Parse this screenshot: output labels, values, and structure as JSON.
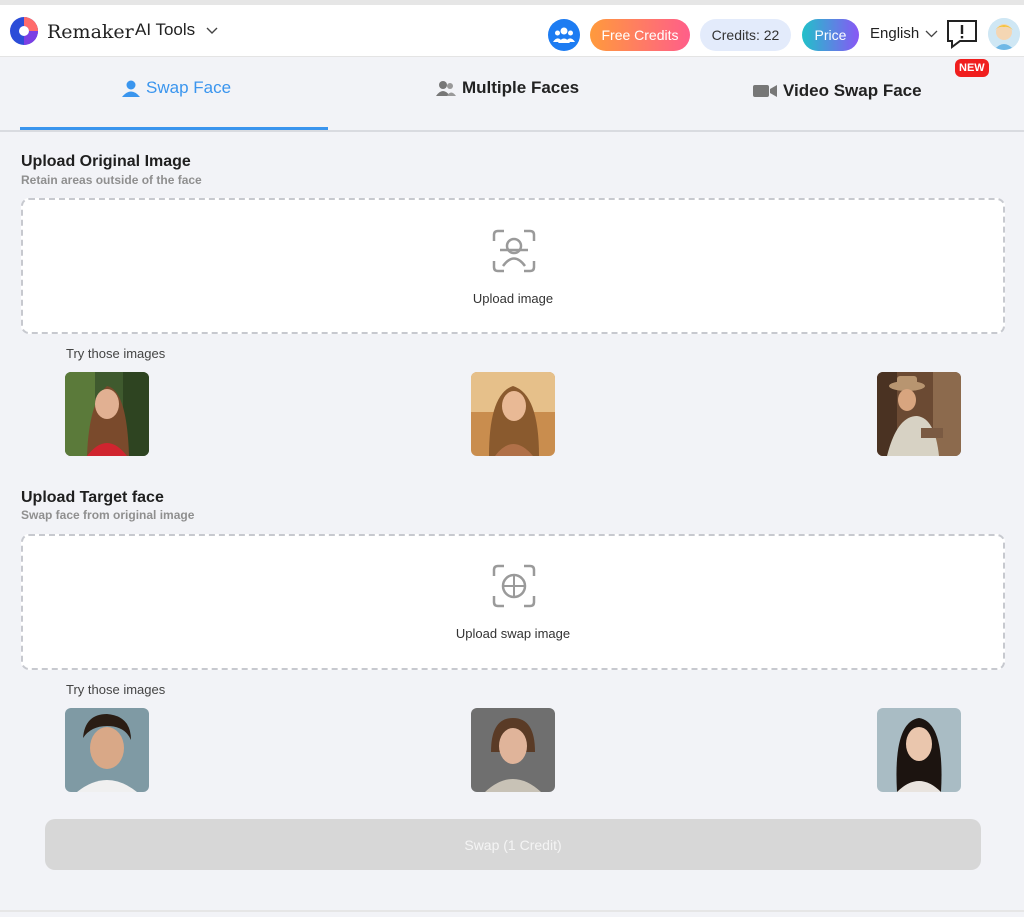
{
  "header": {
    "brand": "Remaker",
    "ai_tools_label": "AI Tools",
    "free_credits_label": "Free Credits",
    "credits_label": "Credits: 22",
    "price_label": "Price",
    "language": "English"
  },
  "tabs": {
    "swap_face": "Swap Face",
    "multiple_faces": "Multiple Faces",
    "video_swap_face": "Video Swap Face",
    "new_badge": "NEW"
  },
  "original": {
    "title": "Upload Original Image",
    "subtitle": "Retain areas outside of the face",
    "upload_label": "Upload image",
    "try_label": "Try those images"
  },
  "target": {
    "title": "Upload Target face",
    "subtitle": "Swap face from original image",
    "upload_label": "Upload swap image",
    "try_label": "Try those images"
  },
  "swap_button": "Swap (1 Credit)",
  "colors": {
    "accent": "#3a95ee",
    "new_badge": "#f01e1e",
    "free_credits_start": "#ff9a3c",
    "free_credits_end": "#ff5e8a",
    "price_start": "#21c1c9",
    "price_end": "#8857f5"
  }
}
